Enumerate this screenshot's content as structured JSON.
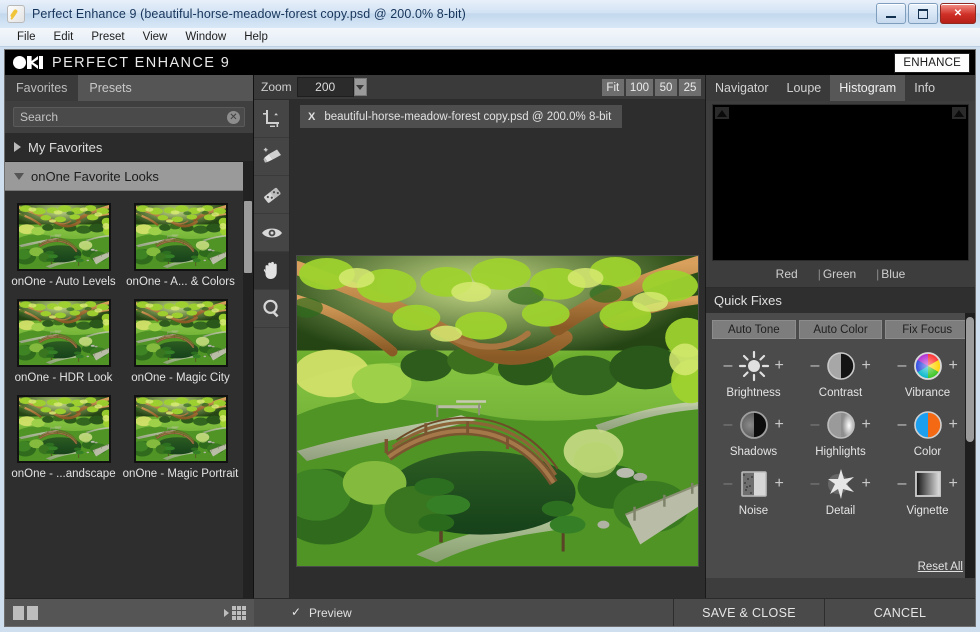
{
  "window": {
    "title": "Perfect Enhance 9 (beautiful-horse-meadow-forest copy.psd @ 200.0% 8-bit)",
    "minimize": "_",
    "maximize": "□",
    "close": "✕"
  },
  "menubar": [
    "File",
    "Edit",
    "Preset",
    "View",
    "Window",
    "Help"
  ],
  "brand": {
    "name": "PERFECT ENHANCE 9",
    "module_button": "ENHANCE"
  },
  "left_panel": {
    "tabs": [
      {
        "label": "Favorites",
        "active": true
      },
      {
        "label": "Presets",
        "active": false
      }
    ],
    "search": {
      "placeholder": "Search",
      "value": "",
      "clear_icon": "close-circle-icon"
    },
    "groups": [
      {
        "label": "My Favorites",
        "expanded": false
      },
      {
        "label": "onOne Favorite Looks",
        "expanded": true
      }
    ],
    "presets": [
      {
        "label": "onOne - Auto Levels"
      },
      {
        "label": "onOne - A... & Colors"
      },
      {
        "label": "onOne - HDR Look"
      },
      {
        "label": "onOne - Magic City"
      },
      {
        "label": "onOne - ...andscape"
      },
      {
        "label": "onOne - Magic Portrait"
      }
    ],
    "footer": {
      "view_mode_icon": "two-up-view-icon",
      "browse_icon": "grid-view-icon"
    }
  },
  "tools": [
    {
      "name": "crop-tool",
      "selected": false
    },
    {
      "name": "retouch-brush-tool",
      "selected": false
    },
    {
      "name": "perfect-eraser-tool",
      "selected": false
    },
    {
      "name": "red-eye-tool",
      "selected": false
    },
    {
      "name": "pan-hand-tool",
      "selected": true
    },
    {
      "name": "zoom-tool",
      "selected": false
    }
  ],
  "zoom_bar": {
    "label": "Zoom",
    "value": "200",
    "dropdown_icon": "chevron-down-icon",
    "presets": [
      "Fit",
      "100",
      "50",
      "25"
    ]
  },
  "canvas": {
    "file_tab": {
      "close_icon": "X",
      "name": "beautiful-horse-meadow-forest copy.psd @ 200.0% 8-bit"
    },
    "image_alt": "Japanese garden with arched moon bridge, green lawns and overhanging tree branches"
  },
  "right_panel": {
    "tabs": [
      {
        "label": "Navigator",
        "active": false
      },
      {
        "label": "Loupe",
        "active": false
      },
      {
        "label": "Histogram",
        "active": true
      },
      {
        "label": "Info",
        "active": false
      }
    ],
    "channels": [
      {
        "label": "Red",
        "pipe": ""
      },
      {
        "label": "Green",
        "pipe": "|"
      },
      {
        "label": "Blue",
        "pipe": "|"
      }
    ],
    "quick_fixes": {
      "title": "Quick Fixes",
      "auto_buttons": [
        "Auto Tone",
        "Auto Color",
        "Fix Focus"
      ],
      "controls": [
        {
          "label": "Brightness",
          "icon": "sun-icon",
          "minus": "–",
          "plus": "+",
          "minus_dim": false
        },
        {
          "label": "Contrast",
          "icon": "contrast-circle-icon",
          "minus": "–",
          "plus": "+",
          "minus_dim": false
        },
        {
          "label": "Vibrance",
          "icon": "color-wheel-icon",
          "minus": "–",
          "plus": "+",
          "minus_dim": false
        },
        {
          "label": "Shadows",
          "icon": "shadows-circle-icon",
          "minus": "–",
          "plus": "+",
          "minus_dim": true
        },
        {
          "label": "Highlights",
          "icon": "highlights-circle-icon",
          "minus": "–",
          "plus": "+",
          "minus_dim": true
        },
        {
          "label": "Color",
          "icon": "color-split-icon",
          "minus": "–",
          "plus": "+",
          "minus_dim": false
        },
        {
          "label": "Noise",
          "icon": "noise-square-icon",
          "minus": "–",
          "plus": "+",
          "minus_dim": true
        },
        {
          "label": "Detail",
          "icon": "detail-star-icon",
          "minus": "–",
          "plus": "+",
          "minus_dim": true
        },
        {
          "label": "Vignette",
          "icon": "vignette-square-icon",
          "minus": "–",
          "plus": "+",
          "minus_dim": false
        }
      ],
      "reset_all": "Reset All"
    }
  },
  "bottom_bar": {
    "preview": {
      "label": "Preview",
      "checked": true,
      "check_glyph": "✓"
    },
    "save_close": "SAVE & CLOSE",
    "cancel": "CANCEL"
  },
  "colors": {
    "brand_black": "#000000",
    "panel_dark": "#2e2e2e",
    "panel_mid": "#3d3d3d",
    "panel_light": "#4b4b4b",
    "accent_selected": "#9a9a9a",
    "canvas_bg": "#2d2d2d",
    "titlebar_text": "#17355b"
  }
}
